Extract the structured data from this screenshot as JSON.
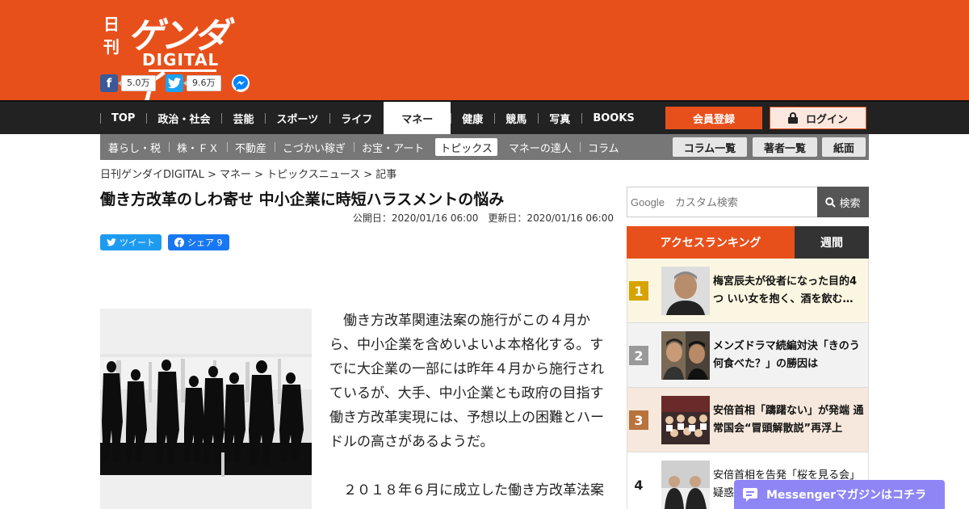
{
  "brand": {
    "kanji": "日刊",
    "name": "ゲンダイ",
    "sub": "DIGITAL"
  },
  "social": {
    "facebook_count": "5.0万",
    "twitter_count": "9.6万"
  },
  "nav": {
    "items": [
      "TOP",
      "政治・社会",
      "芸能",
      "スポーツ",
      "ライフ",
      "マネー",
      "健康",
      "競馬",
      "写真",
      "BOOKS"
    ],
    "active": "マネー",
    "register": "会員登録",
    "login": "ログイン"
  },
  "subnav": {
    "items": [
      "暮らし・税",
      "株・ＦＸ",
      "不動産",
      "こづかい稼ぎ",
      "お宝・アート",
      "トピックス",
      "マネーの達人",
      "コラム"
    ],
    "active": "トピックス",
    "btn_columns": "コラム一覧",
    "btn_authors": "著者一覧",
    "btn_paper": "紙面"
  },
  "breadcrumb": "日刊ゲンダイDIGITAL > マネー > トピックスニュース > 記事",
  "article": {
    "title": "働き方改革のしわ寄せ 中小企業に時短ハラスメントの悩み",
    "dates": "公開日：2020/01/16 06:00　更新日：2020/01/16 06:00",
    "tweet": "ツイート",
    "share": "シェア 9",
    "paragraph1": "　働き方改革関連法案の施行がこの４月から、中小企業を含めいよいよ本格化する。すでに大企業の一部には昨年４月から施行されているが、大手、中小企業とも政府の目指す働き方改革実現には、予想以上の困難とハードルの高さがあるようだ。",
    "paragraph2": "　２０１８年６月に成立した働き方改革法案"
  },
  "search": {
    "placeholder": "Google　カスタム検索",
    "button": "検索"
  },
  "ranking": {
    "tab_main": "アクセスランキング",
    "tab_week": "週間",
    "items": [
      {
        "rank": "1",
        "text": "梅宮辰夫が役者になった目的4つ いい女を抱く、酒を飲む…"
      },
      {
        "rank": "2",
        "text": "メンズドラマ続編対決「きのう何食べた？」の勝因は"
      },
      {
        "rank": "3",
        "text": "安倍首相「躊躇ない」が発端 通常国会“冒頭解散説”再浮上"
      },
      {
        "rank": "4",
        "text": "安倍首相を告発「桜を見る会」疑惑"
      }
    ]
  },
  "messenger": {
    "label": "Messengerマガジンはコチラ"
  },
  "colors": {
    "brand": "#e8501b",
    "nav_bg": "#222222",
    "subnav_bg": "#777777",
    "messenger": "#8e86f5"
  }
}
